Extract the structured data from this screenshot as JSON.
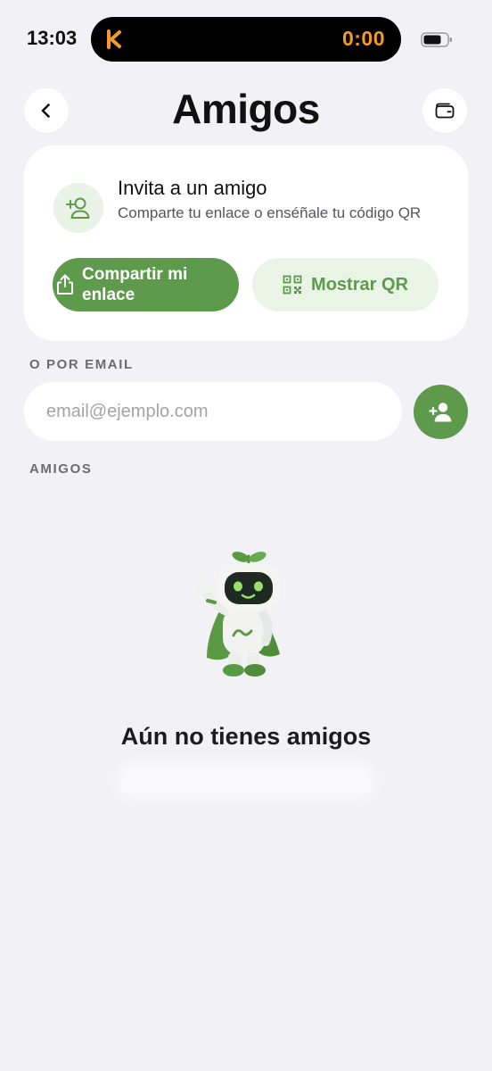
{
  "status_bar": {
    "time": "13:03",
    "activity_timer": "0:00",
    "activity_logo": "K"
  },
  "header": {
    "title": "Amigos",
    "back_icon": "chevron-left-icon",
    "wallet_icon": "wallet-icon"
  },
  "invite": {
    "title": "Invita a un amigo",
    "subtitle": "Comparte tu enlace o enséñale tu código QR",
    "share_button": "Compartir mi enlace",
    "qr_button": "Mostrar QR"
  },
  "email_section": {
    "label": "O POR EMAIL",
    "placeholder": "email@ejemplo.com"
  },
  "friends_section": {
    "label": "AMIGOS",
    "empty_title": "Aún no tienes amigos"
  },
  "colors": {
    "accent": "#5e9a4c",
    "accent_soft": "#e9f3e6",
    "background": "#f2f2f6",
    "timer": "#f59a2a"
  }
}
